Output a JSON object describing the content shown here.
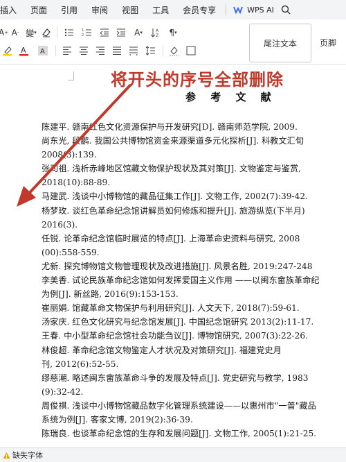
{
  "menu": {
    "items": [
      "插入",
      "页面",
      "引用",
      "审阅",
      "视图",
      "工具",
      "会员专享"
    ],
    "wps_ai_label": "WPS AI",
    "search_icon": "search-icon"
  },
  "ribbon": {
    "style_normal": "尾注文本",
    "style_footer": "页脚"
  },
  "annotation": {
    "text": "将开头的序号全部删除",
    "color": "#c0392b"
  },
  "document": {
    "heading": "参 考 文 献",
    "lines": [
      "陈建平. 赣南红色文化资源保护与开发研究[D]. 赣南师范学院, 2009.",
      "尚东光, 段鹏. 我国公共博物馆资金来源渠道多元化探析[J]. 科教文汇旬",
      "2008(3):139.",
      "张司祖. 浅析赤峰地区馆藏文物保护现状及其对策[J]. 文物鉴定与鉴赏,",
      "2018(10):88-89.",
      "马建武. 浅谈中小博物馆的藏品征集工作[J]. 文物工作, 2002(7):39-42.",
      "杨梦玫. 谈红色革命纪念馆讲解员如何修炼和提升[J]. 旅游纵览(下半月)",
      "2016(3).",
      "任锐. 论革命纪念馆临时展览的特点[J]. 上海革命史资料与研究, 2008",
      "(00):558-559.",
      "尤新. 探究博物馆文物管理现状及改进措施[J]. 风景名胜, 2019:247-248",
      "李美香. 试论民族革命纪念馆如何发挥爱国主义作用 ——以闽东畲族革命纪",
      "为例[J]. 新丝路, 2016(9):153-153.",
      "崔丽娟. 馆藏革命文物保护与利用研究[J]. 人文天下, 2018(7):59-61.",
      "汤家庆. 红色文化研究与纪念馆发展[J]. 中国纪念馆研究 2013(2):11-17.",
      "王春. 中小型革命纪念馆社会功能刍议[J]. 博物馆研究, 2007(3):22-26.",
      "林俊超. 革命纪念馆文物鉴定人才状况及对策研究[J]. 福建党史月",
      "刊, 2012(6):52-55.",
      "缪慈潮. 略述闽东畲族革命斗争的发展及特点[J]. 党史研究与教学, 1983",
      "(9):32-42.",
      "周俊祺. 浅谈中小博物馆藏品数字化管理系统建设——以惠州市\"一普\"藏品",
      "系统为例[J]. 客家文博, 2019(2):36-39.",
      "陈瑞良. 也谈革命纪念馆的生存和发展问题[J]. 文物工作, 2005(1):21-25."
    ]
  },
  "status": {
    "missing_font": "缺失字体"
  }
}
